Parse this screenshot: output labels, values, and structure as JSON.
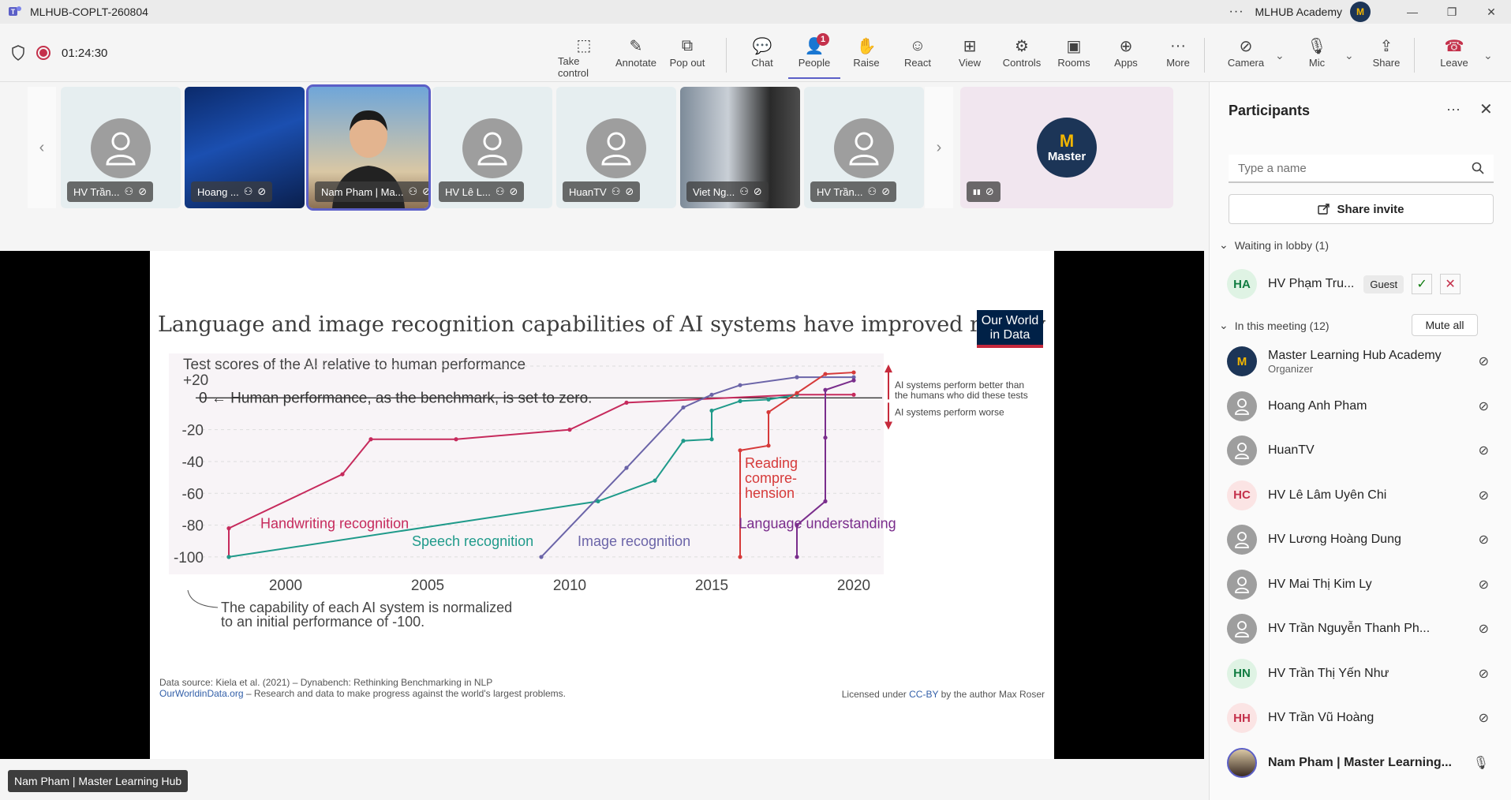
{
  "window": {
    "title": "MLHUB-COPLT-260804",
    "more": "···",
    "org_name": "MLHUB Academy",
    "org_avatar": "M",
    "minimize": "—",
    "restore": "❐",
    "close": "✕"
  },
  "toolbar": {
    "timer": "01:24:30",
    "buttons": [
      {
        "label": "Take control",
        "icon": "take-control-icon"
      },
      {
        "label": "Annotate",
        "icon": "pen-icon"
      },
      {
        "label": "Pop out",
        "icon": "pop-out-icon"
      },
      {
        "label": "Chat",
        "icon": "chat-icon"
      },
      {
        "label": "People",
        "icon": "people-icon",
        "badge": "1"
      },
      {
        "label": "Raise",
        "icon": "hand-icon"
      },
      {
        "label": "React",
        "icon": "smile-icon"
      },
      {
        "label": "View",
        "icon": "grid-icon"
      },
      {
        "label": "Controls",
        "icon": "controls-icon"
      },
      {
        "label": "Rooms",
        "icon": "rooms-icon"
      },
      {
        "label": "Apps",
        "icon": "apps-icon"
      },
      {
        "label": "More",
        "icon": "more-icon"
      },
      {
        "label": "Camera",
        "icon": "camera-off-icon"
      },
      {
        "label": "Mic",
        "icon": "mic-off-icon"
      },
      {
        "label": "Share",
        "icon": "share-icon"
      },
      {
        "label": "Leave",
        "icon": "hangup-icon"
      }
    ]
  },
  "gallery": {
    "tiles": [
      {
        "name": "HV Trần...",
        "type": "avatar"
      },
      {
        "name": "Hoang ...",
        "type": "video-blue"
      },
      {
        "name": "Nam Pham | Ma...",
        "type": "video-person"
      },
      {
        "name": "HV Lê L...",
        "type": "avatar"
      },
      {
        "name": "HuanTV",
        "type": "avatar"
      },
      {
        "name": "Viet Ng...",
        "type": "video-dark"
      },
      {
        "name": "HV Trần...",
        "type": "avatar"
      },
      {
        "name": "",
        "type": "logo",
        "logo_text": "Master"
      }
    ]
  },
  "slide": {
    "title": "Language and image recognition capabilities of AI systems have improved rapidly",
    "owid_line1": "Our World",
    "owid_line2": "in Data",
    "footnote_normalized": "The capability of each AI system is normalized",
    "footnote_normalized2": "to an initial performance of -100.",
    "source": "Data source: Kiela et al. (2021) – Dynabench: Rethinking Benchmarking in NLP",
    "owid_link": "OurWorldinData.org",
    "owid_tagline": " – Research and data to make progress against the world's largest problems.",
    "license_prefix": "Licensed under ",
    "license_link": "CC-BY",
    "license_suffix": " by the author Max Roser"
  },
  "chart_data": {
    "type": "line",
    "title": "Language and image recognition capabilities of AI systems have improved rapidly",
    "subtitle": "Test scores of the AI relative to human performance",
    "ylabel_top": "+20",
    "benchmark_label": "0 ← Human performance, as the benchmark, is set to zero.",
    "xlim": [
      1996,
      2021
    ],
    "ylim": [
      -105,
      25
    ],
    "xticks": [
      "2000",
      "2005",
      "2010",
      "2015",
      "2020"
    ],
    "yticks": [
      "-20",
      "-40",
      "-60",
      "-80",
      "-100"
    ],
    "annotation_better": [
      "AI systems perform better than",
      "the humans who did these tests"
    ],
    "annotation_worse": "AI systems perform worse",
    "series": [
      {
        "name": "Handwriting recognition",
        "color": "#c62a5c",
        "x": [
          1998,
          1998,
          2002,
          2003,
          2006,
          2010,
          2012,
          2018,
          2020
        ],
        "y": [
          -100,
          -82,
          -48,
          -26,
          -26,
          -20,
          -3,
          2,
          2
        ]
      },
      {
        "name": "Speech recognition",
        "color": "#1f9a8a",
        "x": [
          1998,
          2011,
          2013,
          2014,
          2015,
          2015,
          2016,
          2017,
          2018
        ],
        "y": [
          -100,
          -65,
          -52,
          -27,
          -26,
          -8,
          -2,
          -1,
          2
        ]
      },
      {
        "name": "Image recognition",
        "color": "#6b64a8",
        "x": [
          2009,
          2012,
          2014,
          2015,
          2016,
          2018,
          2020
        ],
        "y": [
          -100,
          -44,
          -6,
          2,
          8,
          13,
          13
        ]
      },
      {
        "name": "Reading comprehension",
        "label_lines": [
          "Reading",
          "compre-",
          "hension"
        ],
        "color": "#d63a3a",
        "x": [
          2016,
          2016,
          2017,
          2017,
          2018,
          2019,
          2020
        ],
        "y": [
          -100,
          -33,
          -30,
          -9,
          3,
          15,
          16
        ]
      },
      {
        "name": "Language understanding",
        "color": "#7a2d8c",
        "x": [
          2018,
          2018,
          2019,
          2019,
          2019,
          2020
        ],
        "y": [
          -100,
          -80,
          -65,
          -25,
          5,
          11
        ]
      }
    ]
  },
  "presenter": "Nam Pham | Master Learning Hub",
  "panel": {
    "title": "Participants",
    "more": "···",
    "close": "✕",
    "search_placeholder": "Type a name",
    "share_invite": "Share invite",
    "lobby_label": "Waiting in lobby (1)",
    "lobby": [
      {
        "initials": "HA",
        "name": "HV Phạm Tru...",
        "tag": "Guest"
      }
    ],
    "meeting_label": "In this meeting (12)",
    "mute_all": "Mute all",
    "members": [
      {
        "name": "Master Learning Hub Academy",
        "sub": "Organizer",
        "avatar": "logo"
      },
      {
        "name": "Hoang Anh Pham",
        "avatar": "grey"
      },
      {
        "name": "HuanTV",
        "avatar": "grey"
      },
      {
        "name": "HV Lê Lâm Uyên Chi",
        "avatar": "HC",
        "color": "#fbe4e4",
        "fg": "#c4314b"
      },
      {
        "name": "HV Lương Hoàng Dung",
        "avatar": "grey"
      },
      {
        "name": "HV Mai Thị Kim Ly",
        "avatar": "grey"
      },
      {
        "name": "HV Trần Nguyễn Thanh Ph...",
        "avatar": "grey"
      },
      {
        "name": "HV Trần Thị Yến Như",
        "avatar": "HN",
        "color": "#dff3e4",
        "fg": "#107c41"
      },
      {
        "name": "HV Trần Vũ Hoàng",
        "avatar": "HH",
        "color": "#fbe4e4",
        "fg": "#c4314b"
      },
      {
        "name": "Nam Pham | Master Learning...",
        "avatar": "photo",
        "bold": true
      }
    ]
  }
}
